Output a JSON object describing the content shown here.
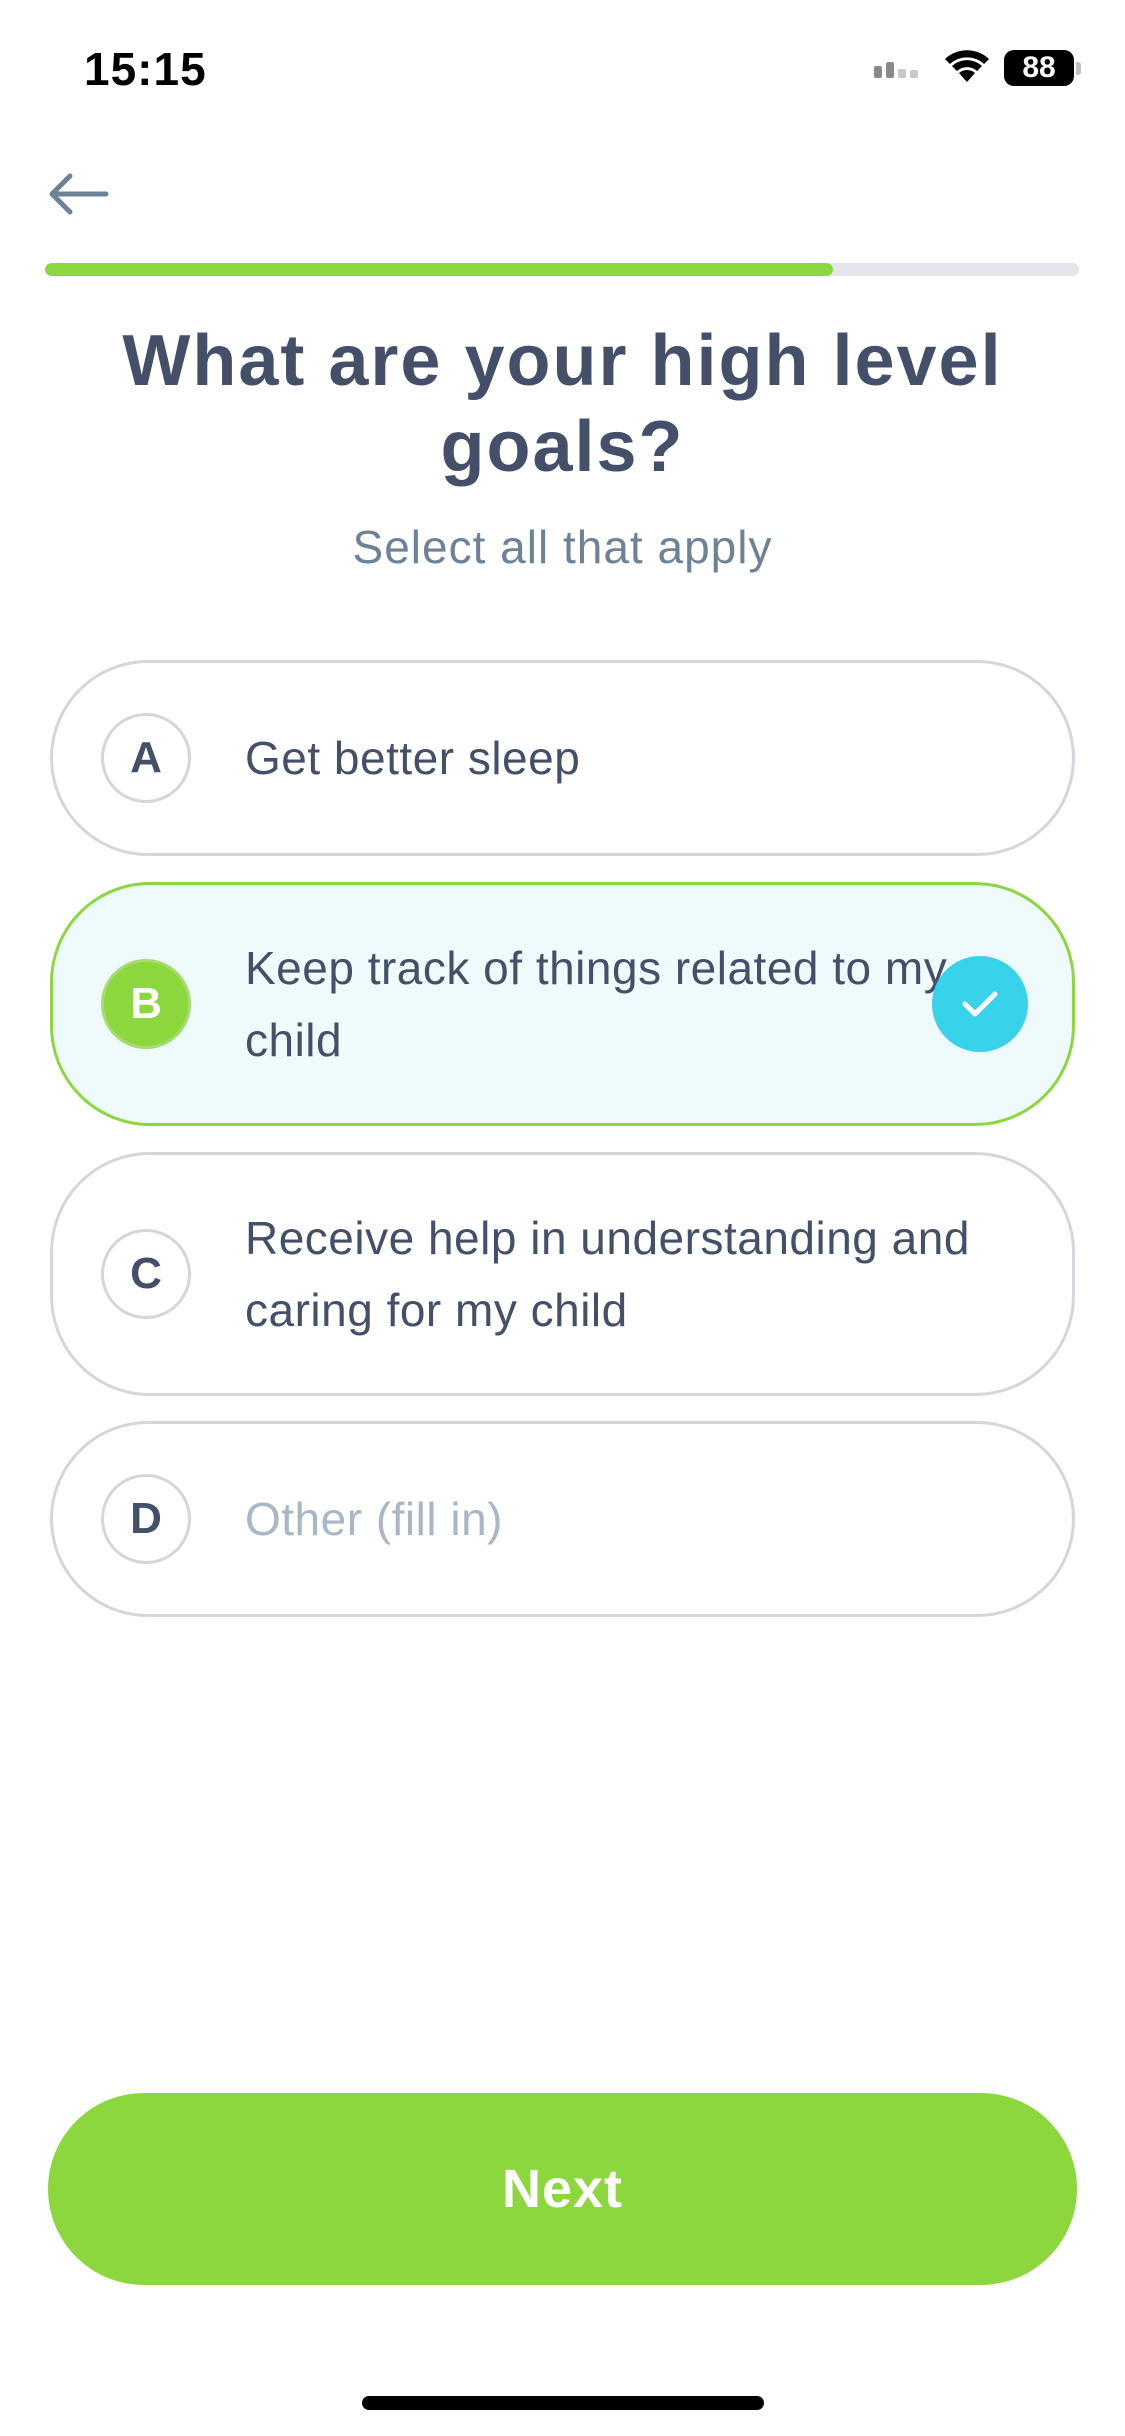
{
  "status_bar": {
    "time": "15:15",
    "battery": "88"
  },
  "nav": {
    "back_icon": "arrow-left-icon"
  },
  "progress": {
    "fraction": 0.762,
    "fill_color": "#8cd63e",
    "track_color": "#e3e7eb"
  },
  "question": {
    "title": "What are your high level goals?",
    "subtitle": "Select all that apply"
  },
  "options": [
    {
      "letter": "A",
      "label": "Get better sleep",
      "selected": false,
      "placeholder": false
    },
    {
      "letter": "B",
      "label": "Keep track of things related to my child",
      "selected": true,
      "placeholder": false
    },
    {
      "letter": "C",
      "label": "Receive help in understanding and caring for my child",
      "selected": false,
      "placeholder": false
    },
    {
      "letter": "D",
      "label": "Other (fill in)",
      "selected": false,
      "placeholder": true
    }
  ],
  "next_button": {
    "label": "Next"
  },
  "colors": {
    "accent_green": "#8cd63e",
    "check_cyan": "#38d3ea",
    "text_dark": "#44506a",
    "text_muted": "#6e8297",
    "selected_bg": "#eefafb"
  }
}
